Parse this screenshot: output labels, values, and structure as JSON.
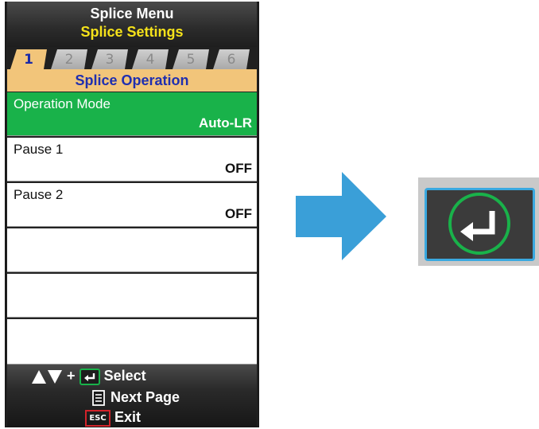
{
  "header": {
    "menu_title": "Splice Menu",
    "settings_title": "Splice Settings"
  },
  "tabs": [
    {
      "label": "1",
      "active": true
    },
    {
      "label": "2",
      "active": false
    },
    {
      "label": "3",
      "active": false
    },
    {
      "label": "4",
      "active": false
    },
    {
      "label": "5",
      "active": false
    },
    {
      "label": "6",
      "active": false
    }
  ],
  "section_title": "Splice Operation",
  "items": [
    {
      "label": "Operation Mode",
      "value": "Auto-LR",
      "selected": true
    },
    {
      "label": "Pause 1",
      "value": "OFF",
      "selected": false
    },
    {
      "label": "Pause 2",
      "value": "OFF",
      "selected": false
    },
    {
      "label": "",
      "value": "",
      "selected": false
    },
    {
      "label": "",
      "value": "",
      "selected": false
    },
    {
      "label": "",
      "value": "",
      "selected": false
    }
  ],
  "footer": {
    "select_hint": "Select",
    "next_page_hint": "Next Page",
    "exit_hint": "Exit",
    "esc_label": "ESC",
    "plus": "+"
  },
  "icons": {
    "arrow_right": "arrow-right-icon",
    "enter_key": "enter-key-icon"
  },
  "colors": {
    "highlight_green": "#19b24a",
    "tab_active": "#f2c57a",
    "title_yellow": "#f5e21a",
    "section_blue": "#1f2fb0",
    "arrow_blue": "#3a9fd8",
    "key_border": "#3aa9e0"
  }
}
